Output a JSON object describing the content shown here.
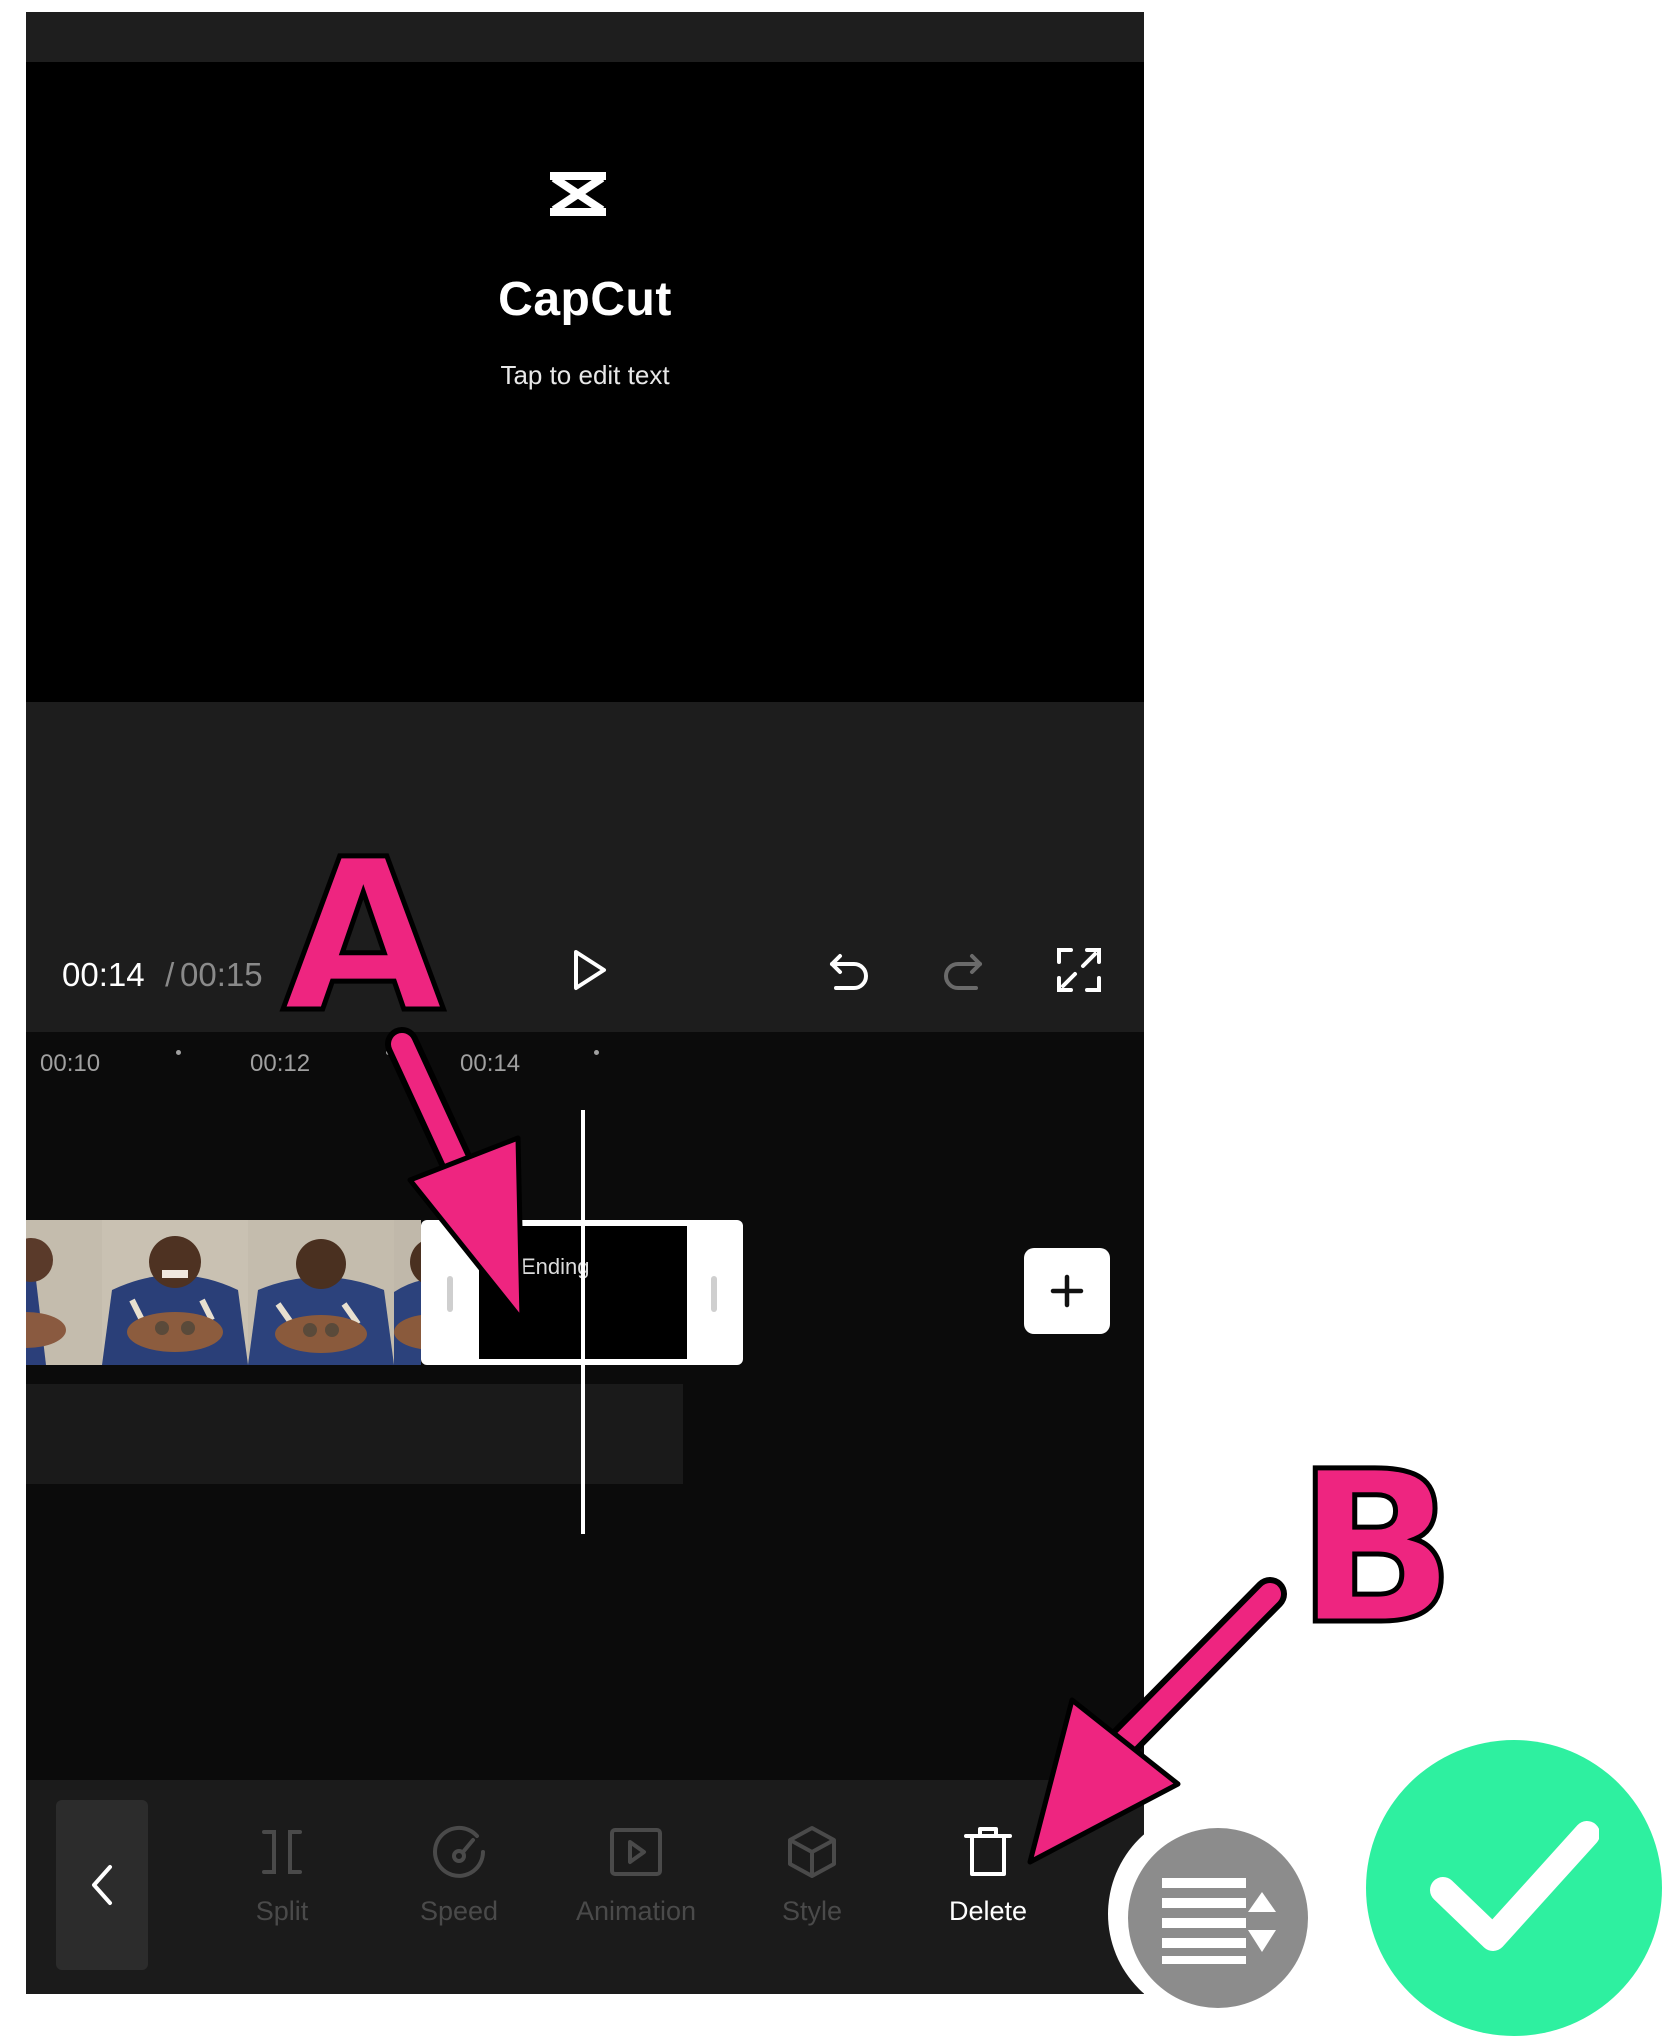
{
  "preview": {
    "logo_text": "CapCut",
    "tap_text": "Tap to edit text"
  },
  "playback": {
    "current_time": "00:14",
    "separator": " / ",
    "total_time": "00:15"
  },
  "timeline": {
    "ticks": [
      "00:10",
      "00:12",
      "00:14"
    ],
    "ending_clip_label": "Ending"
  },
  "toolbar": {
    "items": [
      {
        "label": "Split",
        "icon": "split-icon",
        "enabled": false
      },
      {
        "label": "Speed",
        "icon": "speed-icon",
        "enabled": false
      },
      {
        "label": "Animation",
        "icon": "animation-icon",
        "enabled": false
      },
      {
        "label": "Style",
        "icon": "style-icon",
        "enabled": false
      },
      {
        "label": "Delete",
        "icon": "trash-icon",
        "enabled": true
      }
    ]
  },
  "annotations": {
    "label_a": "A",
    "label_b": "B"
  },
  "colors": {
    "annotation_pink": "#ee2580",
    "confirm_green": "#2ef0a0",
    "menu_gray": "#8c8c8c"
  }
}
